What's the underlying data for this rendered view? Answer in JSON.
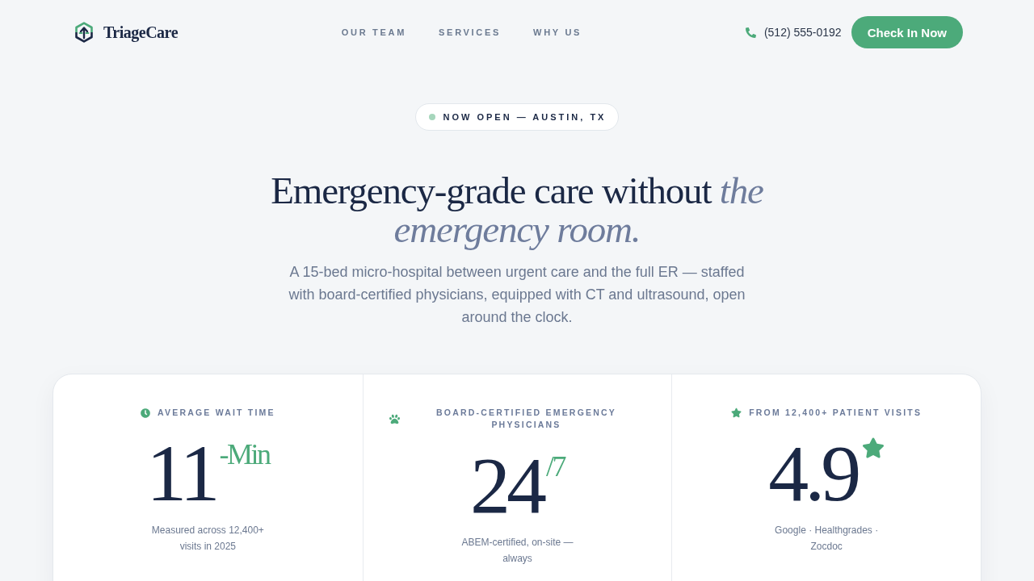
{
  "header": {
    "brand": "TriageCare",
    "nav": [
      {
        "label": "OUR TEAM"
      },
      {
        "label": "SERVICES"
      },
      {
        "label": "WHY US"
      }
    ],
    "phone": "(512) 555-0192",
    "cta": "Check In Now"
  },
  "hero": {
    "badge": "NOW OPEN — AUSTIN, TX",
    "title": "Emergency-grade care without *the emergency room.*",
    "subtitle": "A 15-bed micro-hospital between urgent care and the full ER — staffed with board-certified physicians, equipped with CT and ultrasound, open around the clock."
  },
  "stats": [
    {
      "kind": "wait",
      "label": "AVERAGE WAIT TIME",
      "value": "11",
      "suffix": "-Min",
      "note": "Measured across 12,400+ visits in 2025"
    },
    {
      "kind": "physicians",
      "label": "BOARD-CERTIFIED EMERGENCY PHYSICIANS",
      "value": "24",
      "suffix": "/7",
      "note": "ABEM-certified, on-site — always"
    },
    {
      "kind": "rating",
      "label": "FROM 12,400+ PATIENT VISITS",
      "value": "4.9",
      "note": "Google · Healthgrades · Zocdoc"
    }
  ]
}
